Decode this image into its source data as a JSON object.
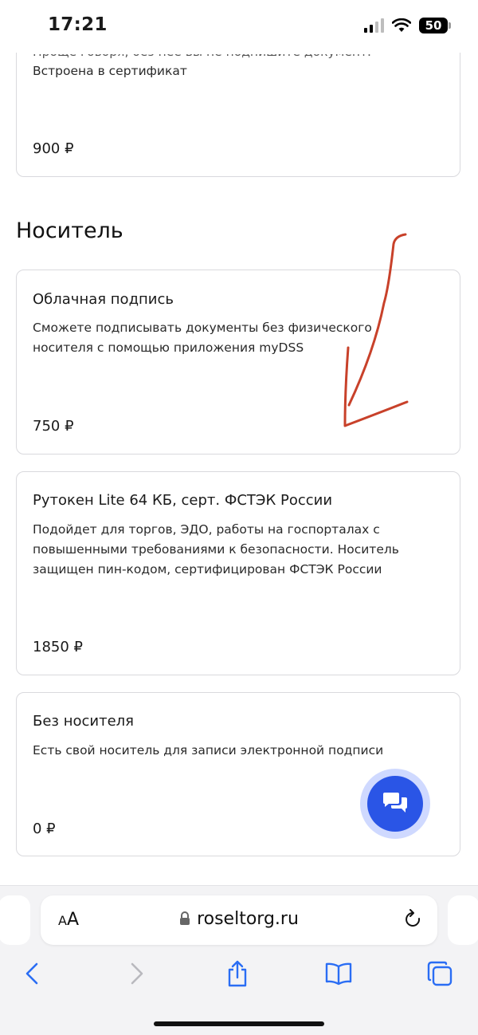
{
  "status_bar": {
    "time": "17:21",
    "battery": "50"
  },
  "cards": [
    {
      "desc_cut": "Проще говоря, без нее вы не подпишите документ.",
      "desc": "Встроена в сертификат",
      "price": "900 ₽"
    },
    {
      "title": "Облачная подпись",
      "desc": "Сможете подписывать документы без физического носителя с помощью приложения myDSS",
      "price": "750 ₽"
    },
    {
      "title": "Рутокен Lite 64 КБ, серт. ФСТЭК России",
      "desc": "Подойдет для торгов, ЭДО, работы на госпорталах с повышенными требованиями к безопасности. Носитель защищен пин-кодом, сертифицирован ФСТЭК России",
      "price": "1850 ₽"
    },
    {
      "title": "Без носителя",
      "desc": "Есть свой носитель для записи электронной подписи",
      "price": "0 ₽"
    }
  ],
  "section": {
    "title": "Носитель"
  },
  "browser": {
    "aa_small": "A",
    "aa_large": "A",
    "url": "roseltorg.ru"
  },
  "colors": {
    "accent": "#2a55e6",
    "annotation": "#c8412a",
    "card_border": "#d9d9dd"
  },
  "icons": [
    "chat-icon",
    "lock-icon",
    "reload-icon",
    "back-icon",
    "forward-icon",
    "share-icon",
    "bookmarks-icon",
    "tabs-icon"
  ]
}
